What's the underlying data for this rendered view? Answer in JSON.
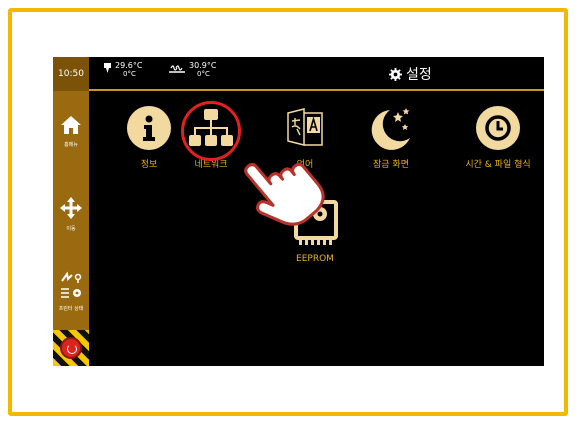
{
  "status": {
    "time": "10:50",
    "temp1_value": "29.6°C",
    "temp1_target": "0°C",
    "temp2_value": "30.9°C",
    "temp2_target": "0°C"
  },
  "header": {
    "title": "설정"
  },
  "sidebar": {
    "home_label": "홈메뉴",
    "move_label": "이동",
    "status_label": "프린터 상태"
  },
  "menu": {
    "info": "정보",
    "network": "네트워크",
    "language": "언어",
    "lock": "잠금 화면",
    "time": "시간 & 파일 형식",
    "eeprom": "EEPROM"
  },
  "colors": {
    "frame": "#f5b800",
    "sidebar": "#9a6a10",
    "accent": "#e8b020",
    "icon_bg": "#f2d9a0",
    "highlight": "#e32020"
  }
}
